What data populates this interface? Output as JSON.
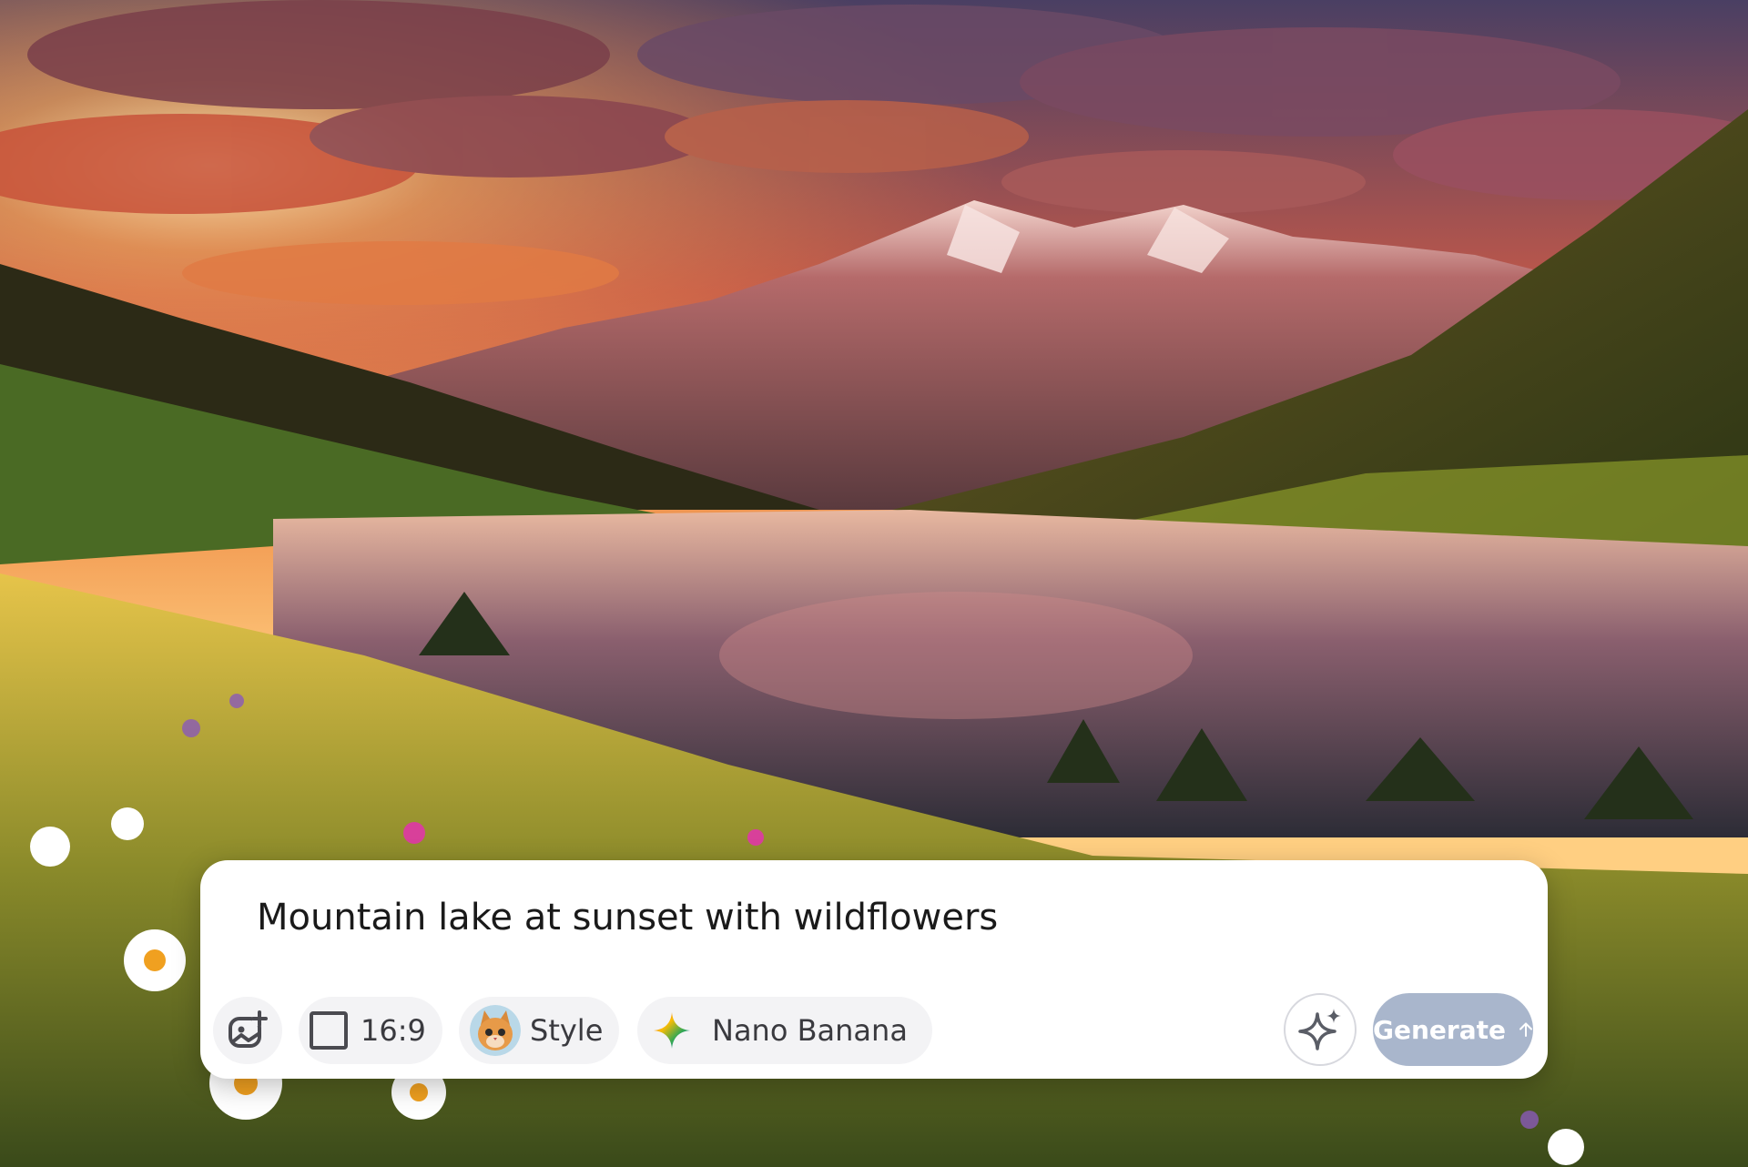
{
  "background": {
    "icon": "landscape-photo",
    "colors": {
      "sky_top": "#5a4a6e",
      "sun": "#ffb347",
      "mountain": "#7a4a52",
      "forest": "#2f3a1c",
      "lake": "#3d3848",
      "meadow": "#c9a83a"
    }
  },
  "prompt": {
    "text": "Mountain lake at sunset with wildflowers"
  },
  "toolbar": {
    "image_button_icon": "add-image-icon",
    "ratio_label": "16:9",
    "style_label": "Style",
    "style_avatar_icon": "cat-avatar-icon",
    "model_label": "Nano Banana",
    "model_icon": "gemini-sparkle-icon",
    "enhance_icon": "sparkle-icon",
    "generate_label": "Generate",
    "generate_icon": "arrow-up-icon"
  },
  "colors": {
    "card": "#ffffff",
    "pill": "#f3f3f5",
    "generate": "#a9b6cc",
    "text": "#1a1a1a"
  }
}
